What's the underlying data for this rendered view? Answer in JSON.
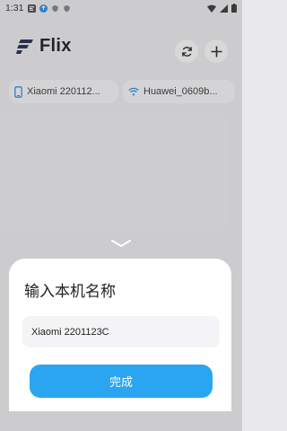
{
  "status_bar": {
    "time": "1:31"
  },
  "header": {
    "title": "Flix"
  },
  "devices": [
    {
      "label": "Xiaomi 220112...",
      "icon": "phone-icon"
    },
    {
      "label": "Huawei_0609b...",
      "icon": "wifi-icon"
    }
  ],
  "bottom_sheet": {
    "title": "输入本机名称",
    "device_name_value": "Xiaomi 2201123C",
    "done_label": "完成"
  },
  "colors": {
    "accent": "#2aa6f0",
    "sheet_bg": "#ffffff",
    "field_bg": "#f4f4f6"
  }
}
